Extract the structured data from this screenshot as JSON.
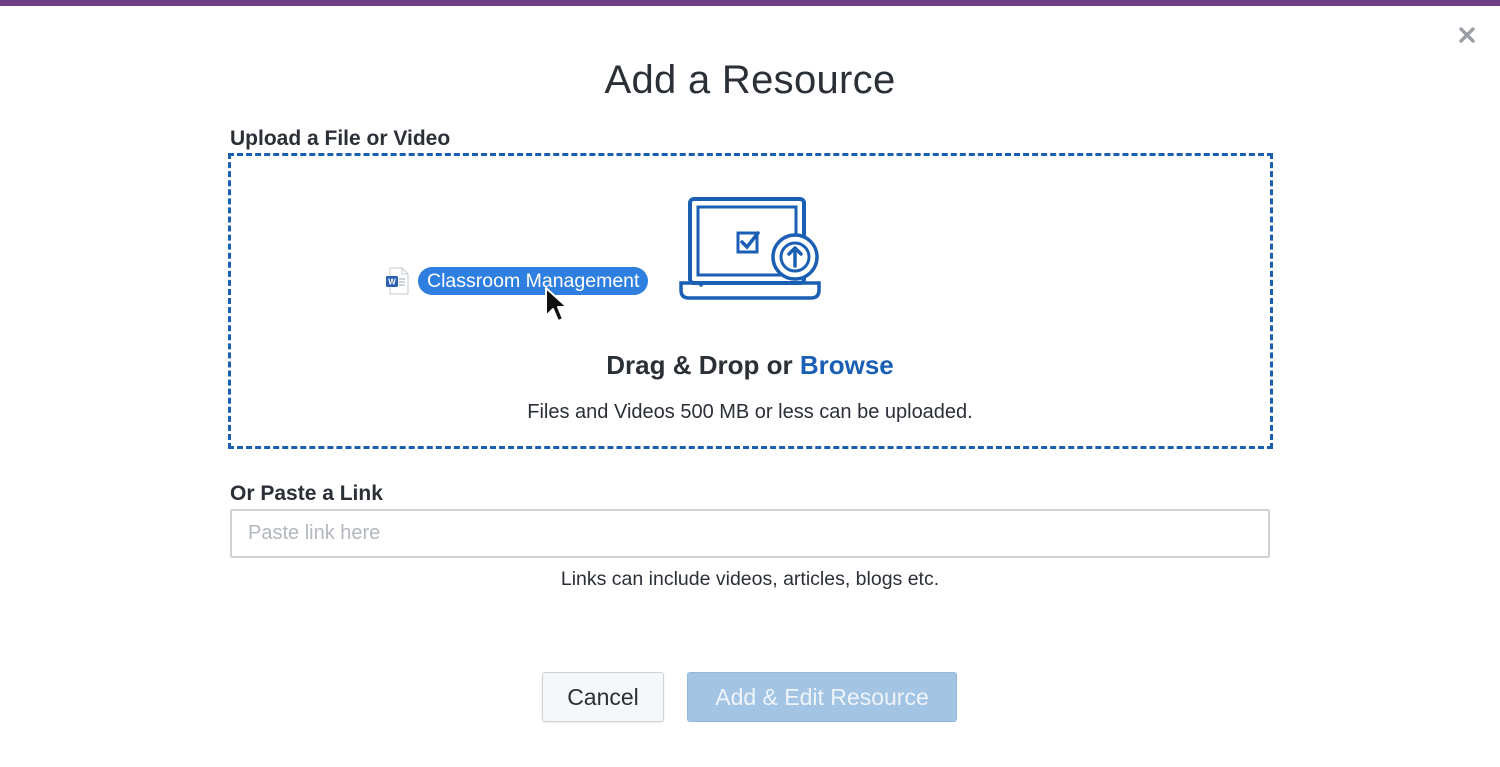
{
  "dialog": {
    "title": "Add a Resource",
    "close_icon": "close-icon"
  },
  "upload": {
    "label": "Upload a File or Video",
    "dragged_file": {
      "name": "Classroom Management",
      "icon": "word-document-icon"
    },
    "illustration_icon": "laptop-upload-icon",
    "prompt_prefix": "Drag & Drop or",
    "browse_label": "Browse",
    "size_note": "Files and Videos 500 MB or less can be uploaded."
  },
  "link": {
    "label": "Or Paste a Link",
    "placeholder": "Paste link here",
    "value": "",
    "note": "Links can include videos, articles, blogs etc."
  },
  "actions": {
    "cancel_label": "Cancel",
    "submit_label": "Add & Edit Resource",
    "submit_disabled": true
  },
  "colors": {
    "brand_bar": "#6e3f86",
    "accent": "#1a5fb4",
    "file_chip": "#2f7fe0",
    "submit_disabled": "#a3c4e3"
  }
}
